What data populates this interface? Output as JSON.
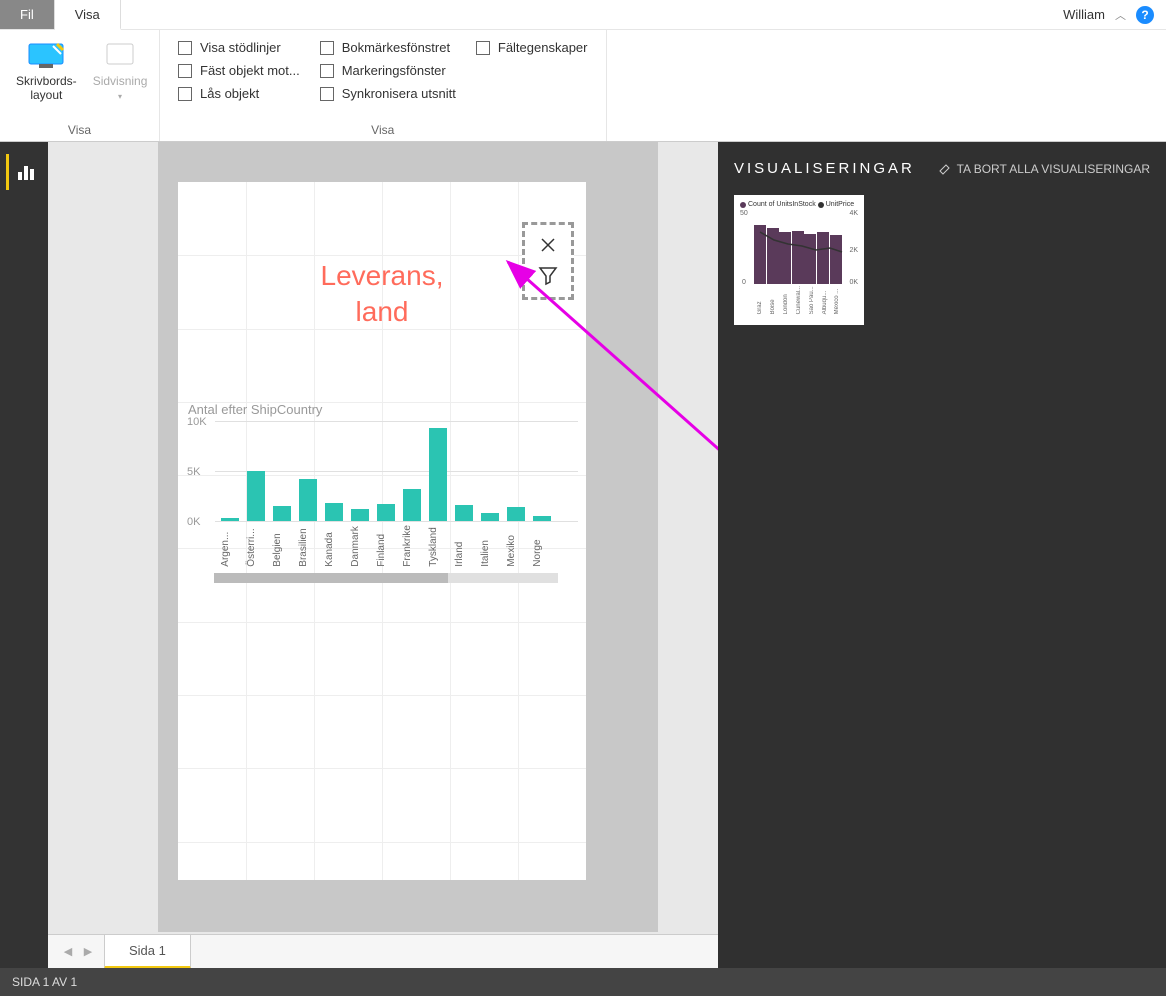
{
  "titlebar": {
    "tabs": {
      "fil": "Fil",
      "visa": "Visa"
    },
    "user": "William"
  },
  "ribbon": {
    "skrivbord": "Skrivbords-\nlayout",
    "sidvisning": "Sidvisning",
    "group1": "Visa",
    "group2": "Visa",
    "checks": {
      "stodlinjer": "Visa stödlinjer",
      "fast": "Fäst objekt mot...",
      "las": "Lås objekt",
      "bokmarkes": "Bokmärkesfönstret",
      "markering": "Markeringsfönster",
      "synkronisera": "Synkronisera utsnitt",
      "faltegenskaper": "Fältegenskaper"
    }
  },
  "visual": {
    "title": "Leverans,\nland"
  },
  "panel": {
    "title": "VISUALISERINGAR",
    "clear": "TA BORT ALLA VISUALISERINGAR"
  },
  "thumb": {
    "legend1": "Count of UnitsInStock",
    "legend2": "UnitPrice",
    "yleft": [
      "50",
      "0"
    ],
    "yright": [
      "4K",
      "2K",
      "0K"
    ],
    "xlabels": [
      "Graz",
      "Boise",
      "London",
      "Cunewal...",
      "São Pau...",
      "Albuqu...",
      "México ..."
    ]
  },
  "page_tabs": {
    "page1": "Sida 1"
  },
  "statusbar": "SIDA 1 AV 1",
  "chart_data": {
    "type": "bar",
    "title": "Antal efter ShipCountry",
    "ylabel": "",
    "ylim": [
      0,
      10000
    ],
    "yticks": [
      "10K",
      "5K",
      "0K"
    ],
    "categories": [
      "Argen...",
      "Österri...",
      "Belgien",
      "Brasilien",
      "Kanada",
      "Danmark",
      "Finland",
      "Frankrike",
      "Tyskland",
      "Irland",
      "Italien",
      "Mexiko",
      "Norge"
    ],
    "values": [
      300,
      5000,
      1500,
      4200,
      1800,
      1200,
      1700,
      3200,
      9300,
      1600,
      800,
      1400,
      500
    ]
  }
}
